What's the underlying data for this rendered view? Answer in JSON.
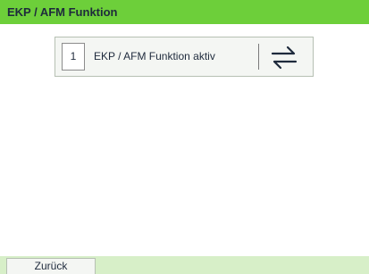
{
  "header": {
    "title": "EKP / AFM Funktion"
  },
  "menu": {
    "items": [
      {
        "number": "1",
        "label": "EKP / AFM Funktion aktiv",
        "icon": "swap-arrows-icon"
      }
    ]
  },
  "footer": {
    "back_label": "Zurück"
  },
  "colors": {
    "title_bar": "#6dcf3a",
    "bottom_bar": "#d7efc8",
    "text": "#1e2a3c"
  }
}
